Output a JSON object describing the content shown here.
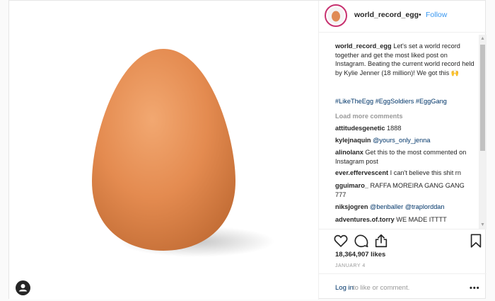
{
  "post": {
    "username": "world_record_egg",
    "separator": "•",
    "follow_label": "Follow",
    "caption": {
      "username": "world_record_egg",
      "text": "Let's set a world record together and get the most liked post on Instagram. Beating the current world record held by Kylie Jenner (18 million)! We got this 🙌",
      "hashtags": "#LikeTheEgg #EggSoldiers #EggGang"
    },
    "load_more_label": "Load more comments",
    "comments": [
      {
        "user": "attitudesgenetic",
        "text": "1888"
      },
      {
        "user": "kylejnaquin",
        "text": "@yours_only_jenna"
      },
      {
        "user": "alinolanx",
        "text": "Get this to the most commented on Instagram post"
      },
      {
        "user": "ever.effervescent",
        "text": "I can't believe this shit rn"
      },
      {
        "user": "gguimaro_",
        "text": "RAFFA MOREIRA GANG GANG 777"
      },
      {
        "user": "niksjogren",
        "text": "@benballer @traplorddan"
      },
      {
        "user": "adventures.of.torry",
        "text": "WE MADE ITTTT"
      }
    ],
    "likes": "18,364,907 likes",
    "date": "JANUARY 4",
    "login_link": "Log in",
    "login_text": "to like or comment.",
    "more_label": "•••"
  },
  "icons": {
    "like": "heart-icon",
    "comment": "comment-bubble-icon",
    "share": "share-icon",
    "save": "bookmark-icon",
    "tag": "user-tag-icon"
  },
  "colors": {
    "egg": "#e08b55",
    "link": "#003569",
    "follow": "#3897f0",
    "avatar_ring": "#c7316f"
  }
}
